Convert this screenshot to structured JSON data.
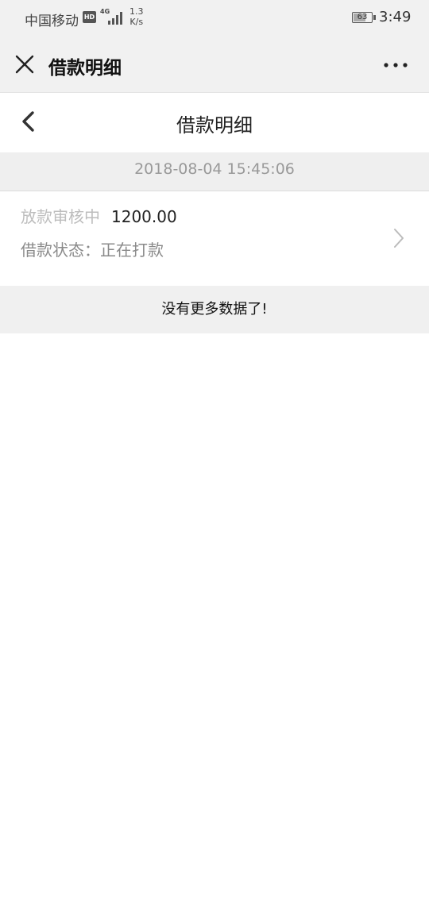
{
  "status_bar": {
    "carrier": "中国移动",
    "hd": "HD",
    "network": "4G",
    "speed_value": "1.3",
    "speed_unit": "K/s",
    "battery": "63",
    "battery_level": 0.63,
    "time": "3:49"
  },
  "top_bar": {
    "title": "借款明细",
    "close_icon": "close-icon",
    "more_icon": "more-dots-icon"
  },
  "nav": {
    "title": "借款明细",
    "back_icon": "chevron-left-icon"
  },
  "loan": {
    "date": "2018-08-04 15:45:06",
    "status_label": "放款审核中",
    "amount": "1200.00",
    "state_text": "借款状态：正在打款",
    "chevron_icon": "chevron-right-icon"
  },
  "footer": {
    "message": "没有更多数据了!"
  },
  "colors": {
    "header_bg": "#f1f1f1",
    "label_gray": "#bdbdbd",
    "footer_bg": "#f0f0f0"
  }
}
